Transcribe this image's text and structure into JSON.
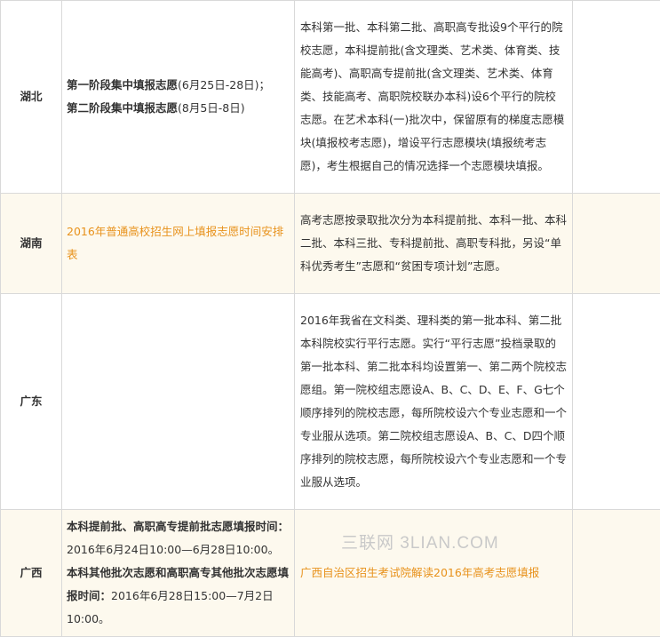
{
  "rows": [
    {
      "province": "湖北",
      "time_lines": [
        "第一阶段集中填报志愿",
        "(6月25日-28日)；",
        "第二阶段集中填报志愿",
        "(8月5日-8日)"
      ],
      "description": "本科第一批、本科第二批、高职高专批设9个平行的院校志愿，本科提前批(含文理类、艺术类、体育类、技能高考)、高职高专提前批(含文理类、艺术类、体育类、技能高考、高职院校联办本科)设6个平行的院校志愿。在艺术本科(一)批次中，保留原有的梯度志愿模块(填报校考志愿)，增设平行志愿模块(填报统考志愿)，考生根据自己的情况选择一个志愿模块填报。"
    },
    {
      "province": "湖南",
      "time_link": "2016年普通高校招生网上填报志愿时间安排表",
      "description": "高考志愿按录取批次分为本科提前批、本科一批、本科二批、本科三批、专科提前批、高职专科批，另设“单科优秀考生”志愿和“贫困专项计划”志愿。"
    },
    {
      "province": "广东",
      "description": "2016年我省在文科类、理科类的第一批本科、第二批本科院校实行平行志愿。实行“平行志愿”投档录取的第一批本科、第二批本科均设置第一、第二两个院校志愿组。第一院校组志愿设A、B、C、D、E、F、G七个顺序排列的院校志愿，每所院校设六个专业志愿和一个专业服从选项。第二院校组志愿设A、B、C、D四个顺序排列的院校志愿，每所院校设六个专业志愿和一个专业服从选项。"
    },
    {
      "province": "广西",
      "time_parts": [
        "本科提前批、高职高专提前批志愿填报时间：",
        "2016年6月24日10:00—6月28日10:00。",
        "本科其他批次志愿和高职高专其他批次志愿填报时间：",
        "2016年6月28日15:00—7月2日10:00。"
      ],
      "description_link": "广西自治区招生考试院解读2016年高考志愿填报"
    }
  ],
  "watermark": "三联网 3LIAN.COM"
}
